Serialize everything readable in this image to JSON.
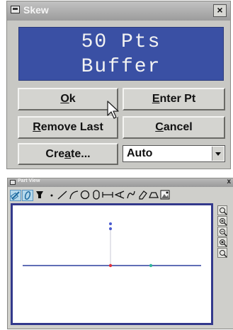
{
  "dialog": {
    "title": "Skew",
    "close_label": "×",
    "display_line1": "50 Pts",
    "display_line2": "Buffer",
    "ok": {
      "u": "O",
      "rest": "k"
    },
    "enter_pt": {
      "u": "E",
      "rest": "nter Pt"
    },
    "remove_last": {
      "u": "R",
      "rest": "emove Last"
    },
    "cancel": {
      "u": "C",
      "rest": "ancel"
    },
    "create": {
      "a": "Cre",
      "u": "a",
      "b": "te..."
    },
    "mode_value": "Auto"
  },
  "part_view": {
    "title": "Part View",
    "close_label": "x",
    "tools": [
      "select-icon",
      "probe-icon",
      "tip-icon",
      "point-icon",
      "line-icon",
      "arc-icon",
      "circle-icon",
      "slot-icon",
      "distance-icon",
      "angle-icon",
      "curve-icon",
      "eraser-icon",
      "profile-icon",
      "image-icon"
    ],
    "zoom_buttons": [
      "zoom-fit-icon",
      "zoom-in-icon",
      "zoom-out-icon",
      "zoom-window-icon",
      "zoom-prev-icon"
    ],
    "colors": {
      "axis": "#2c3e9e",
      "origin": "#e0303c",
      "point_teal": "#2fb39a",
      "point_blue": "#4a5ad0",
      "canvas_border": "#33398c"
    }
  }
}
